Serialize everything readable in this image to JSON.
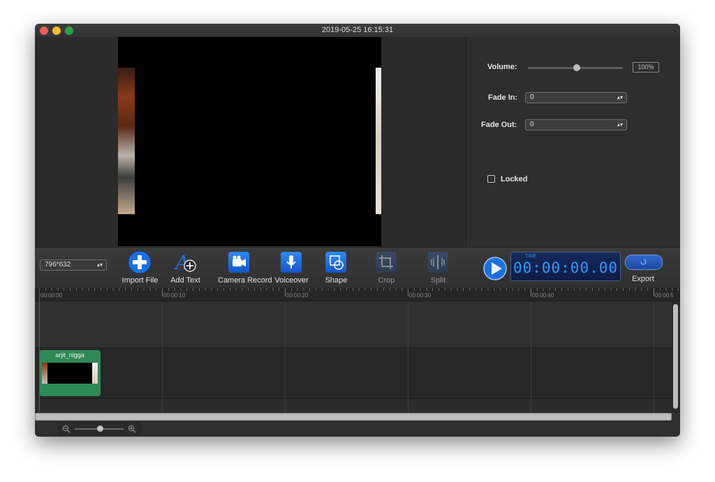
{
  "window": {
    "title": "2019-05-25 16:15:31",
    "traffic_lights": {
      "close": "#ec5f56",
      "minimize": "#f5bd2f",
      "zoom": "#2aa442"
    }
  },
  "properties": {
    "volume_label": "Volume:",
    "volume_value_text": "100%",
    "volume_level": 0.5,
    "fade_in_label": "Fade In:",
    "fade_in_value": "0",
    "fade_out_label": "Fade Out:",
    "fade_out_value": "0",
    "locked_label": "Locked",
    "locked_checked": false
  },
  "toolbar": {
    "resolution_value": "796*632",
    "import_label": "Import File",
    "add_text_label": "Add Text",
    "camera_label": "Camera Record",
    "voiceover_label": "Voiceover",
    "shape_label": "Shape",
    "crop_label": "Crop",
    "split_label": "Split",
    "export_label": "Export",
    "accent": "#1c6fe0"
  },
  "timer": {
    "label": "TIME",
    "time": "00:00:00.00"
  },
  "ruler": {
    "marks": [
      "00:00:00",
      "00:00:10",
      "00:00:20",
      "00:00:30",
      "00:00:40",
      "00:00:5"
    ]
  },
  "clip": {
    "name": "arjit_nigga",
    "color": "#2e8a55"
  }
}
